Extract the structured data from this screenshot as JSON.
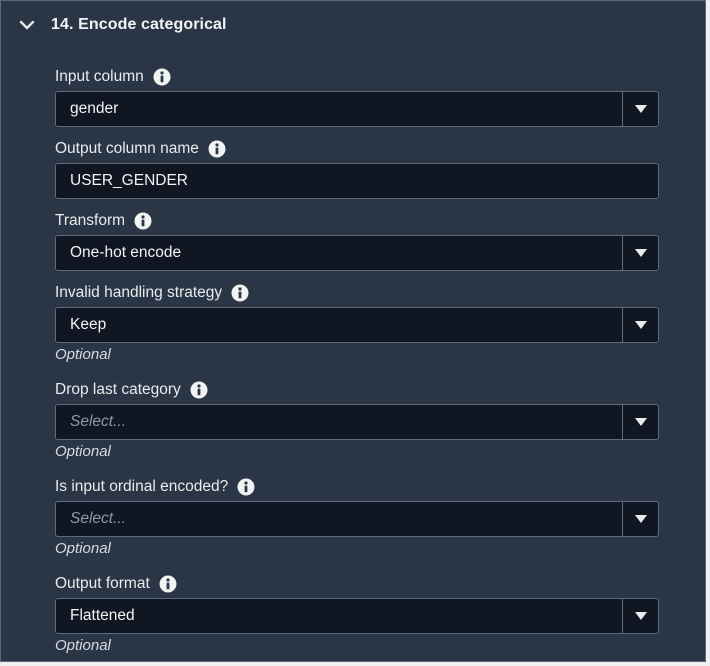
{
  "section": {
    "title": "14. Encode categorical",
    "icon": "chevron-down-icon"
  },
  "fields": [
    {
      "label": "Input column",
      "value": "gender",
      "placeholder": "",
      "optional": ""
    },
    {
      "label": "Output column name",
      "value": "USER_GENDER",
      "placeholder": "",
      "optional": ""
    },
    {
      "label": "Transform",
      "value": "One-hot encode",
      "placeholder": "",
      "optional": ""
    },
    {
      "label": "Invalid handling strategy",
      "value": "Keep",
      "placeholder": "",
      "optional": "Optional"
    },
    {
      "label": "Drop last category",
      "value": "",
      "placeholder": "Select...",
      "optional": "Optional"
    },
    {
      "label": "Is input ordinal encoded?",
      "value": "",
      "placeholder": "Select...",
      "optional": "Optional"
    },
    {
      "label": "Output format",
      "value": "Flattened",
      "placeholder": "",
      "optional": "Optional"
    }
  ],
  "colors": {
    "panel_bg": "#2a3545",
    "control_bg": "#111722",
    "border": "#5f6b7a",
    "text": "#f2f3f3",
    "placeholder": "#8d99a8"
  }
}
